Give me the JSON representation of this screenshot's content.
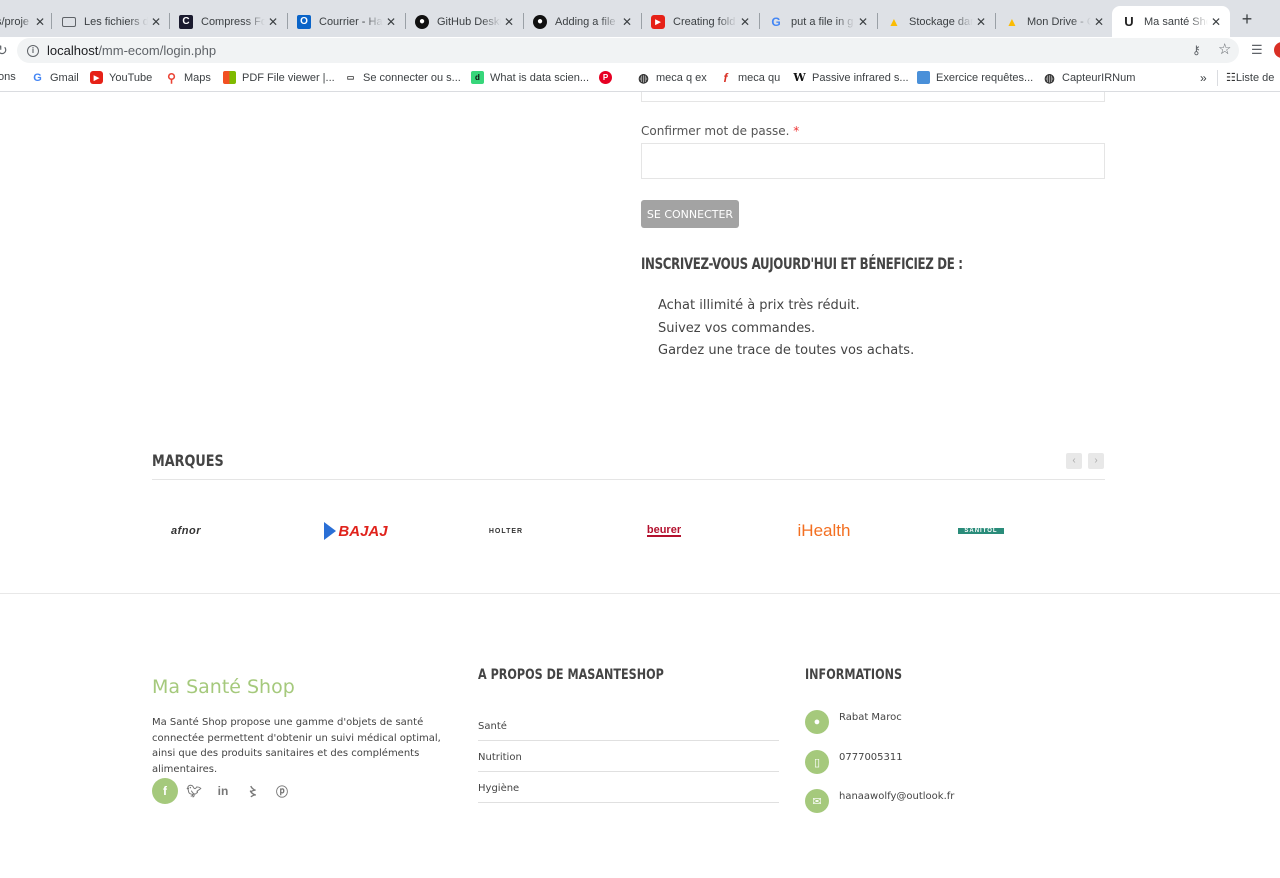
{
  "browser": {
    "tabs": [
      {
        "title": "s/proje",
        "favicon": "page-icon",
        "icon_color": "#888"
      },
      {
        "title": "Les fichiers d",
        "favicon": "window-icon",
        "icon_color": "#5f6368"
      },
      {
        "title": "Compress Fo",
        "favicon": "compress-icon",
        "icon_color": "#1a1a2e"
      },
      {
        "title": "Courrier - Ha",
        "favicon": "outlook-icon",
        "icon_color": "#0a64c8"
      },
      {
        "title": "GitHub Deskt",
        "favicon": "github-icon",
        "icon_color": "#111"
      },
      {
        "title": "Adding a file",
        "favicon": "github-icon",
        "icon_color": "#111"
      },
      {
        "title": "Creating fold",
        "favicon": "youtube-icon",
        "icon_color": "#e62117"
      },
      {
        "title": "put a file in g",
        "favicon": "google-icon",
        "icon_color": "#4285f4"
      },
      {
        "title": "Stockage dan",
        "favicon": "drive-icon",
        "icon_color": "#fbbc04"
      },
      {
        "title": "Mon Drive - G",
        "favicon": "drive-icon",
        "icon_color": "#fbbc04"
      },
      {
        "title": "Ma santé Sho",
        "favicon": "u-icon",
        "icon_color": "#222",
        "active": true
      }
    ],
    "new_tab": "+",
    "url_host": "localhost",
    "url_path": "/mm-ecom/login.php",
    "bookmarks": [
      {
        "label": "ons",
        "icon": "none"
      },
      {
        "label": "Gmail",
        "icon": "google-icon"
      },
      {
        "label": "YouTube",
        "icon": "youtube-icon"
      },
      {
        "label": "Maps",
        "icon": "maps-icon"
      },
      {
        "label": "PDF File viewer |...",
        "icon": "microsoft-icon"
      },
      {
        "label": "Se connecter ou s...",
        "icon": "box-icon"
      },
      {
        "label": "What is data scien...",
        "icon": "dc-icon"
      },
      {
        "label": "",
        "icon": "pinterest-icon"
      },
      {
        "label": "meca q ex",
        "icon": "globe-icon"
      },
      {
        "label": "meca qu",
        "icon": "formula-icon"
      },
      {
        "label": "Passive infrared s...",
        "icon": "wikipedia-icon"
      },
      {
        "label": "Exercice requêtes...",
        "icon": "monitor-icon"
      },
      {
        "label": "CapteurIRNum",
        "icon": "globe-icon"
      }
    ],
    "bookmarks_more": "»",
    "reading_list": "Liste de"
  },
  "form": {
    "confirm_label": "Confirmer mot de passe.",
    "required_mark": "*",
    "confirm_value": "",
    "submit_label": "SE CONNECTER"
  },
  "benefits": {
    "title": "INSCRIVEZ-VOUS AUJOURD'HUI ET BÉNEFICIEZ DE :",
    "items": [
      "Achat illimité à prix très réduit.",
      "Suivez vos commandes.",
      "Gardez une trace de toutes vos achats."
    ]
  },
  "brands": {
    "title": "MARQUES",
    "prev": "‹",
    "next": "›",
    "logos": [
      {
        "name": "afnor",
        "color": "#333"
      },
      {
        "name": "BAJAJ",
        "color": "#e0231c"
      },
      {
        "name": "HOLTER",
        "color": "#333"
      },
      {
        "name": "beurer",
        "color": "#b4112e"
      },
      {
        "name": "iHealth",
        "color": "#f36f21"
      },
      {
        "name": "SANITOL",
        "color": "#2a8c7a"
      }
    ]
  },
  "footer": {
    "shop_name": "Ma Santé Shop",
    "description": "Ma Santé Shop propose une gamme d'objets de santé connectée permettent d'obtenir un suivi médical optimal, ainsi que des produits sanitaires et des compléments alimentaires.",
    "about_title": "A PROPOS DE MASANTESHOP",
    "about_items": [
      "Santé",
      "Nutrition",
      "Hygiène"
    ],
    "info_title": "INFORMATIONS",
    "address": "Rabat Maroc",
    "phone": "0777005311",
    "email": "hanaawolfy@outlook.fr",
    "accent_color": "#a5c97c"
  }
}
